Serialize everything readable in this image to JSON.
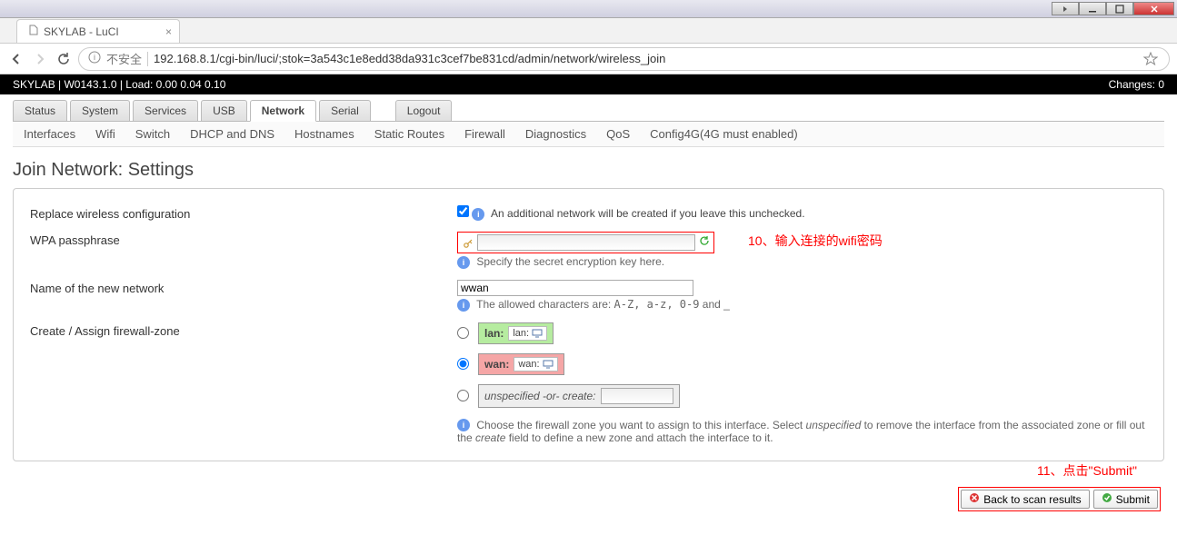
{
  "window": {
    "title": "SKYLAB - LuCI"
  },
  "browser": {
    "unsafe_label": "不安全",
    "url": "192.168.8.1/cgi-bin/luci/;stok=3a543c1e8edd38da931c3cef7be831cd/admin/network/wireless_join"
  },
  "header": {
    "status": "SKYLAB | W0143.1.0 | Load: 0.00 0.04 0.10",
    "changes": "Changes: 0"
  },
  "tabs": {
    "main": [
      "Status",
      "System",
      "Services",
      "USB",
      "Network",
      "Serial",
      "Logout"
    ],
    "active": "Network",
    "sub": [
      "Interfaces",
      "Wifi",
      "Switch",
      "DHCP and DNS",
      "Hostnames",
      "Static Routes",
      "Firewall",
      "Diagnostics",
      "QoS",
      "Config4G(4G must enabled)"
    ]
  },
  "page": {
    "title": "Join Network: Settings",
    "fields": {
      "replace_label": "Replace wireless configuration",
      "replace_checked": true,
      "replace_hint": "An additional network will be created if you leave this unchecked.",
      "wpa_label": "WPA passphrase",
      "wpa_value": "",
      "wpa_hint": "Specify the secret encryption key here.",
      "netname_label": "Name of the new network",
      "netname_value": "wwan",
      "netname_hint_pre": "The allowed characters are: ",
      "netname_hint_code": "A-Z, a-z, 0-9",
      "netname_hint_post": " and _",
      "zone_label": "Create / Assign firewall-zone",
      "zone_lan_label": "lan:",
      "zone_lan_iface": "lan:",
      "zone_wan_label": "wan:",
      "zone_wan_iface": "wan:",
      "zone_selected": "wan",
      "zone_unspec": "unspecified -or- create:",
      "zone_hint": "Choose the firewall zone you want to assign to this interface. Select unspecified to remove the interface from the associated zone or fill out the create field to define a new zone and attach the interface to it."
    },
    "footer": {
      "back": "Back to scan results",
      "submit": "Submit"
    }
  },
  "annotations": {
    "a10": "10、输入连接的wifi密码",
    "a11": "11、点击\"Submit\""
  }
}
